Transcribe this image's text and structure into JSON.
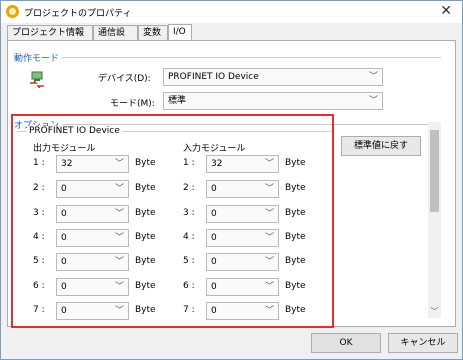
{
  "window": {
    "title": "プロジェクトのプロパティ",
    "close_glyph": "✕"
  },
  "tabs": [
    {
      "label": "プロジェクト情報"
    },
    {
      "label": "通信設定"
    },
    {
      "label": "変数"
    },
    {
      "label": "I/O"
    }
  ],
  "comm_mode": {
    "group_label": "動作モード",
    "device_label": "デバイス(D):",
    "device_value": "PROFINET IO Device",
    "mode_label": "モード(M):",
    "mode_value": "標準"
  },
  "options": {
    "group_label": "オプション",
    "sub_label": "PROFINET IO Device",
    "output_label": "出力モジュール",
    "input_label": "入力モジュール",
    "unit": "Byte",
    "output_rows": [
      {
        "num": "1 :",
        "value": "32"
      },
      {
        "num": "2 :",
        "value": "0"
      },
      {
        "num": "3 :",
        "value": "0"
      },
      {
        "num": "4 :",
        "value": "0"
      },
      {
        "num": "5 :",
        "value": "0"
      },
      {
        "num": "6 :",
        "value": "0"
      },
      {
        "num": "7 :",
        "value": "0"
      }
    ],
    "input_rows": [
      {
        "num": "1 :",
        "value": "32"
      },
      {
        "num": "2 :",
        "value": "0"
      },
      {
        "num": "3 :",
        "value": "0"
      },
      {
        "num": "4 :",
        "value": "0"
      },
      {
        "num": "5 :",
        "value": "0"
      },
      {
        "num": "6 :",
        "value": "0"
      },
      {
        "num": "7 :",
        "value": "0"
      }
    ],
    "reset_button": "標準値に戻す"
  },
  "footer": {
    "ok": "OK",
    "cancel": "キャンセル"
  },
  "colors": {
    "highlight_border": "#e03030",
    "group_label": "#1f5fbf"
  }
}
